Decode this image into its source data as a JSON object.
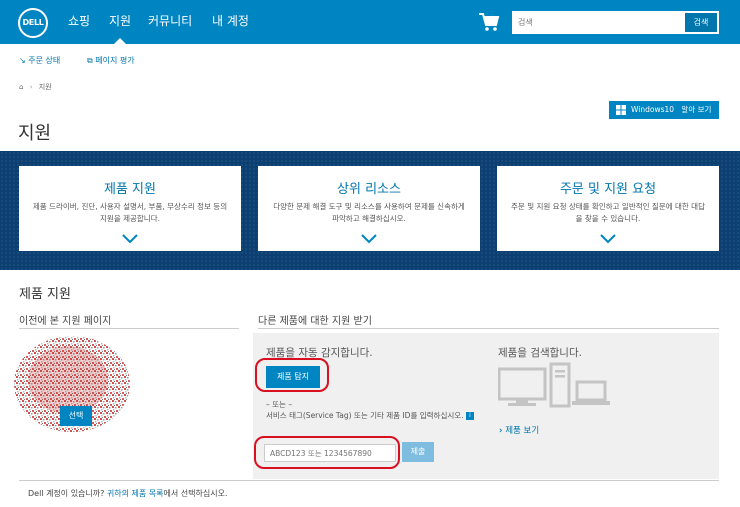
{
  "header": {
    "logo": "DELL",
    "nav": [
      "쇼핑",
      "지원",
      "커뮤니티",
      "내 계정"
    ],
    "active_nav": "지원",
    "search_placeholder": "검색",
    "search_button": "검색"
  },
  "sublinks": {
    "order_status": "주문 상태",
    "page_rating": "페이지 평가"
  },
  "breadcrumb": {
    "current": "지원"
  },
  "windows_button": {
    "name": "Windows10",
    "action": "알아 보기"
  },
  "page_title": "지원",
  "cards": [
    {
      "title": "제품 지원",
      "desc": "제품 드라이버, 진단, 사용자 설명서, 부품, 무상수리 정보 등의 지원을 제공합니다."
    },
    {
      "title": "상위 리소스",
      "desc": "다양한 문제 해결 도구 및 리소스를 사용하여 문제를 신속하게 파악하고 해결하십시오."
    },
    {
      "title": "주문 및 지원 요청",
      "desc": "주문 및 지원 요청 상태를 확인하고 일반적인 질문에 대한 대답을 찾을 수 있습니다."
    }
  ],
  "product_support": {
    "title": "제품 지원",
    "recent_heading": "이전에 본 지원 페이지",
    "select_button": "선택",
    "other_heading": "다른 제품에 대한 지원 받기",
    "auto_detect_title": "제품을 자동 감지합니다.",
    "detect_button": "제품 탐지",
    "or_text": "– 또는 –",
    "service_tag_text": "서비스 태그(Service Tag) 또는 기타 제품 ID를 입력하십시오.",
    "service_tag_placeholder": "ABCD123 또는 1234567890",
    "submit_button": "제출",
    "search_title": "제품을 검색합니다.",
    "view_products": "제품 보기"
  },
  "footer": {
    "prefix": "Dell 계정이 있습니까? ",
    "link": "귀하의 제품 목록",
    "suffix": "에서 선택하십시오."
  },
  "colors": {
    "header_blue": "#0085c3",
    "band_navy": "#0c3f72",
    "link_blue": "#0076ad",
    "highlight_red": "#d8101f"
  }
}
